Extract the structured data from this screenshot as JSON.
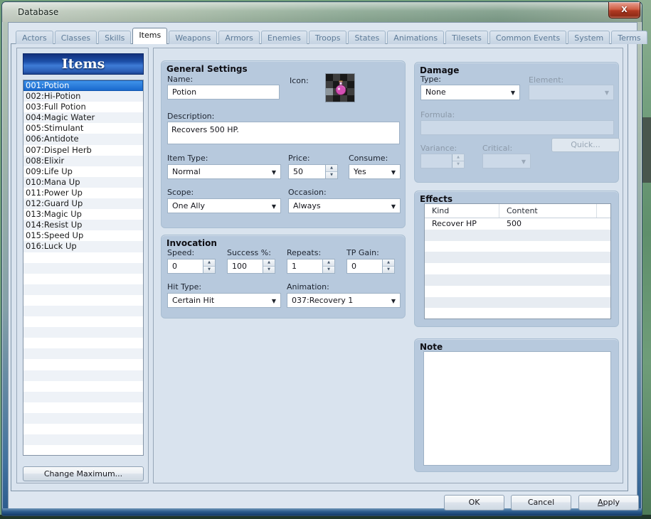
{
  "window": {
    "title": "Database",
    "close_glyph": "X"
  },
  "tabs": {
    "active": "Items",
    "items": [
      "Actors",
      "Classes",
      "Skills",
      "Items",
      "Weapons",
      "Armors",
      "Enemies",
      "Troops",
      "States",
      "Animations",
      "Tilesets",
      "Common Events",
      "System",
      "Terms"
    ]
  },
  "item_list": {
    "header": "Items",
    "selected_index": 0,
    "visible_rows": 35,
    "items": [
      "001:Potion",
      "002:Hi-Potion",
      "003:Full Potion",
      "004:Magic Water",
      "005:Stimulant",
      "006:Antidote",
      "007:Dispel Herb",
      "008:Elixir",
      "009:Life Up",
      "010:Mana Up",
      "011:Power Up",
      "012:Guard Up",
      "013:Magic Up",
      "014:Resist Up",
      "015:Speed Up",
      "016:Luck Up"
    ],
    "change_maximum_label": "Change Maximum..."
  },
  "general_settings": {
    "title": "General Settings",
    "name_label": "Name:",
    "name_value": "Potion",
    "icon_label": "Icon:",
    "icon_name": "potion-icon",
    "description_label": "Description:",
    "description_value": "Recovers 500 HP.",
    "item_type_label": "Item Type:",
    "item_type_value": "Normal",
    "price_label": "Price:",
    "price_value": "50",
    "consume_label": "Consume:",
    "consume_value": "Yes",
    "scope_label": "Scope:",
    "scope_value": "One Ally",
    "occasion_label": "Occasion:",
    "occasion_value": "Always"
  },
  "invocation": {
    "title": "Invocation",
    "speed_label": "Speed:",
    "speed_value": "0",
    "success_label": "Success %:",
    "success_value": "100",
    "repeats_label": "Repeats:",
    "repeats_value": "1",
    "tp_gain_label": "TP Gain:",
    "tp_gain_value": "0",
    "hit_type_label": "Hit Type:",
    "hit_type_value": "Certain Hit",
    "animation_label": "Animation:",
    "animation_value": "037:Recovery 1"
  },
  "damage": {
    "title": "Damage",
    "type_label": "Type:",
    "type_value": "None",
    "element_label": "Element:",
    "element_value": "",
    "formula_label": "Formula:",
    "formula_value": "",
    "variance_label": "Variance:",
    "variance_value": "",
    "critical_label": "Critical:",
    "critical_value": "",
    "quick_label": "Quick..."
  },
  "effects": {
    "title": "Effects",
    "columns": [
      "Kind",
      "Content"
    ],
    "rows": [
      {
        "kind": "Recover HP",
        "content": "500"
      }
    ],
    "empty_rows": 8
  },
  "note": {
    "title": "Note",
    "value": ""
  },
  "dialog_buttons": {
    "ok": "OK",
    "cancel": "Cancel",
    "apply_prefix": "A",
    "apply_rest": "pply"
  },
  "colors": {
    "banner_blue": "#1d4fa8",
    "selection_blue": "#1766cb",
    "close_red": "#b03a22",
    "groupbox": "#b7c9dd"
  }
}
